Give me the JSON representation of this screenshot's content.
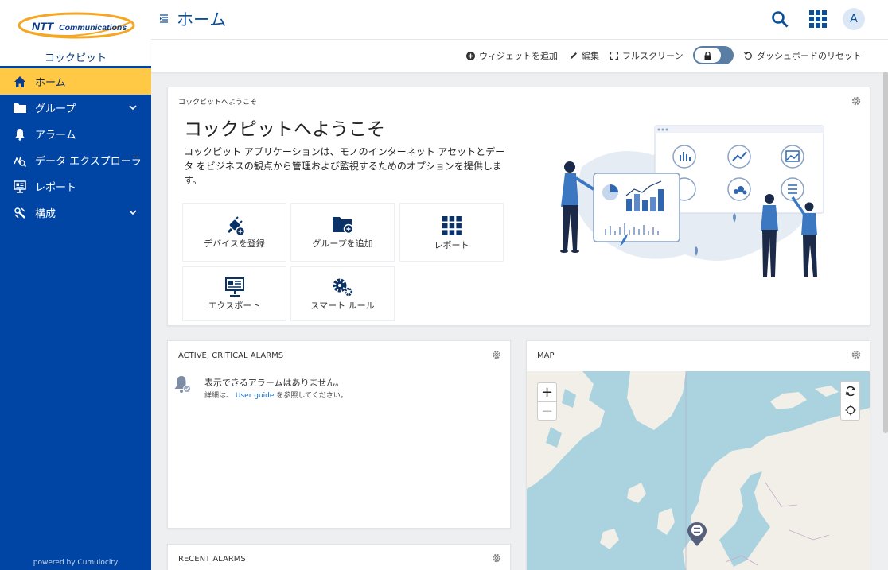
{
  "brand": {
    "logo_text": "NTT Communications",
    "app_name": "コックピット",
    "powered_by": "powered by Cumulocity"
  },
  "sidebar": {
    "items": [
      {
        "label": "ホーム",
        "active": true,
        "icon": "home-icon"
      },
      {
        "label": "グループ",
        "icon": "folder-icon",
        "expandable": true
      },
      {
        "label": "アラーム",
        "icon": "bell-icon"
      },
      {
        "label": "データ エクスプローラ",
        "icon": "data-explorer-icon"
      },
      {
        "label": "レポート",
        "icon": "report-icon"
      },
      {
        "label": "構成",
        "icon": "config-icon",
        "expandable": true
      }
    ]
  },
  "header": {
    "title": "ホーム",
    "avatar_initial": "A"
  },
  "actions": {
    "add_widget": "ウィジェットを追加",
    "edit": "編集",
    "fullscreen": "フルスクリーン",
    "reset": "ダッシュボードのリセット"
  },
  "welcome": {
    "card_title": "コックピットへようこそ",
    "heading": "コックピットへようこそ",
    "description": "コックピット アプリケーションは、モノのインターネット アセットとデータ をビジネスの観点から管理および監視するためのオプションを提供します。",
    "tiles": [
      {
        "label": "デバイスを登録",
        "icon": "plug-add-icon"
      },
      {
        "label": "グループを追加",
        "icon": "folder-add-icon"
      },
      {
        "label": "レポート",
        "icon": "grid-icon"
      },
      {
        "label": "エクスポート",
        "icon": "presentation-icon"
      },
      {
        "label": "スマート ルール",
        "icon": "gears-icon"
      }
    ]
  },
  "alarms_card": {
    "title": "ACTIVE, CRITICAL ALARMS",
    "empty_message": "表示できるアラームはありません。",
    "detail_prefix": "詳細は、",
    "link": "User guide",
    "detail_suffix": "を参照してください。"
  },
  "map_card": {
    "title": "MAP",
    "zoom_in": "+",
    "zoom_out": "−"
  },
  "recent_card": {
    "title": "RECENT ALARMS"
  },
  "colors": {
    "sidebar": "#0045a4",
    "active": "#ffc845",
    "accent": "#0a4f9c",
    "sea": "#aad3df",
    "land": "#f2efe9"
  }
}
